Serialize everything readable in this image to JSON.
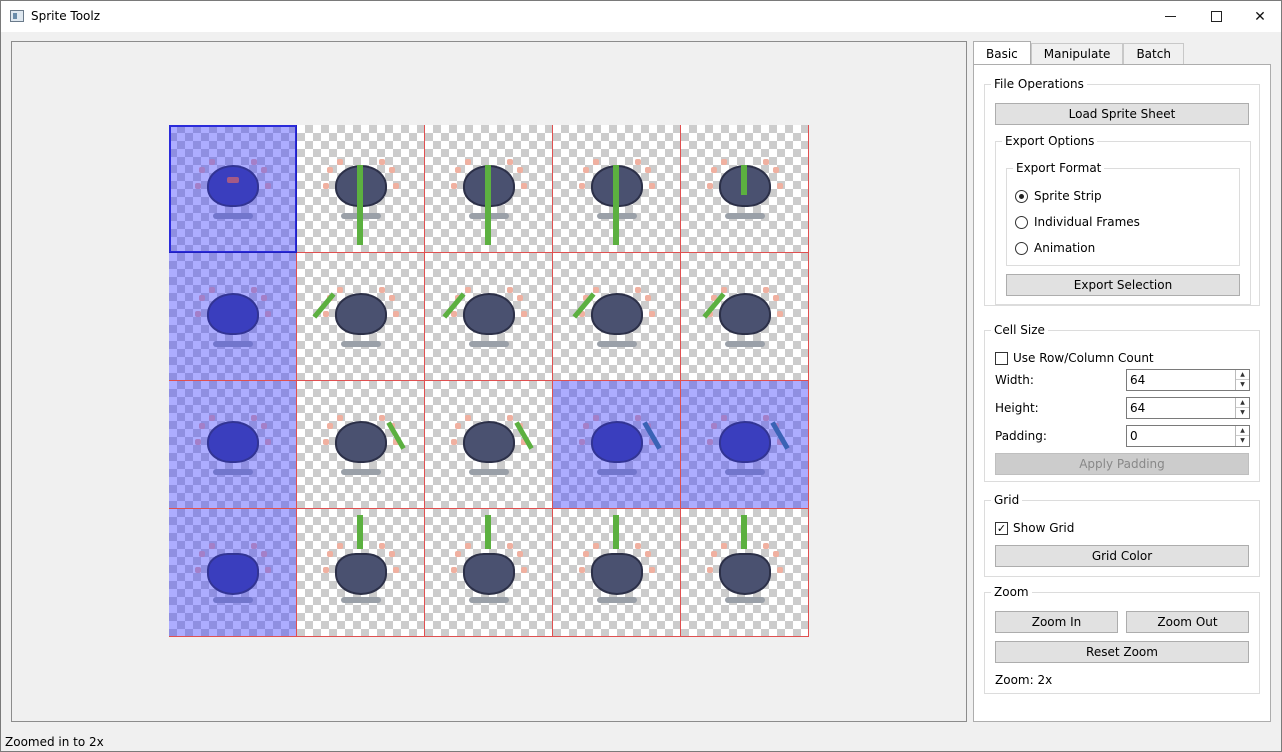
{
  "window": {
    "title": "Sprite Toolz",
    "minimize": "minimize",
    "maximize": "maximize",
    "close_symbol": "✕"
  },
  "tabs": [
    {
      "label": "Basic",
      "active": true
    },
    {
      "label": "Manipulate",
      "active": false
    },
    {
      "label": "Batch",
      "active": false
    }
  ],
  "file_operations": {
    "title": "File Operations",
    "load_label": "Load Sprite Sheet",
    "export_options": {
      "title": "Export Options",
      "format": {
        "title": "Export Format",
        "options": [
          {
            "label": "Sprite Strip",
            "checked": true
          },
          {
            "label": "Individual Frames",
            "checked": false
          },
          {
            "label": "Animation",
            "checked": false
          }
        ]
      },
      "export_label": "Export Selection"
    }
  },
  "cell_size": {
    "title": "Cell Size",
    "use_row_column_label": "Use Row/Column Count",
    "use_row_column_checked": false,
    "width_label": "Width:",
    "width_value": "64",
    "height_label": "Height:",
    "height_value": "64",
    "padding_label": "Padding:",
    "padding_value": "0",
    "apply_padding_label": "Apply Padding"
  },
  "grid": {
    "title": "Grid",
    "show_grid_label": "Show Grid",
    "show_grid_checked": true,
    "check_mark": "✓",
    "grid_color_label": "Grid Color"
  },
  "zoom": {
    "title": "Zoom",
    "zoom_in_label": "Zoom In",
    "zoom_out_label": "Zoom Out",
    "reset_label": "Reset Zoom",
    "level_text": "Zoom: 2x"
  },
  "status": {
    "text": "Zoomed in to 2x"
  },
  "sprite_sheet": {
    "rows": 4,
    "cols": 5,
    "grid_color": "#e05050",
    "selection_color": "#3c3cff",
    "selected_cells": [
      [
        0,
        0
      ],
      [
        1,
        0
      ],
      [
        2,
        0
      ],
      [
        3,
        0
      ],
      [
        2,
        3
      ],
      [
        2,
        4
      ]
    ],
    "current_cell": [
      0,
      0
    ]
  }
}
